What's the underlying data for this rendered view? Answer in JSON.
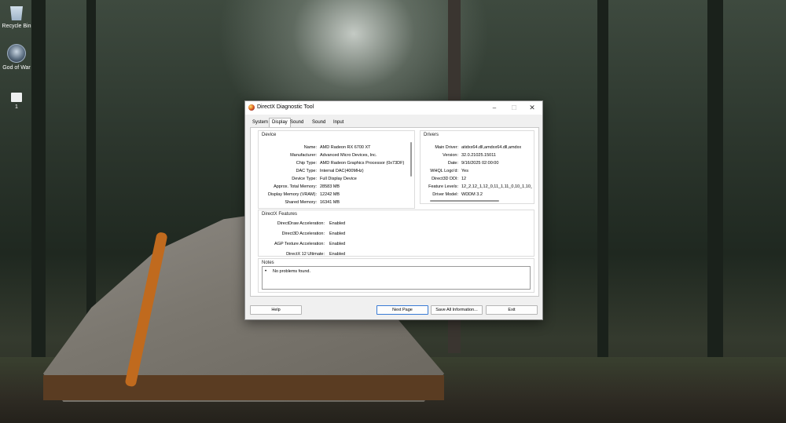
{
  "desktop": {
    "icons": [
      {
        "label": "Recycle Bin"
      },
      {
        "label": "God of War"
      },
      {
        "label": "1"
      }
    ]
  },
  "dialog": {
    "title": "DirectX Diagnostic Tool",
    "tabs": [
      "System",
      "Display",
      "Sound 1",
      "Sound 2",
      "Input"
    ],
    "active_tab": "Display",
    "device": {
      "label": "Device",
      "rows": [
        {
          "key": "Name:",
          "value": "AMD Radeon RX 6700 XT"
        },
        {
          "key": "Manufacturer:",
          "value": "Advanced Micro Devices, Inc."
        },
        {
          "key": "Chip Type:",
          "value": "AMD Radeon Graphics Processor (0x73DF)"
        },
        {
          "key": "DAC Type:",
          "value": "Internal DAC(400MHz)"
        },
        {
          "key": "Device Type:",
          "value": "Full Display Device"
        },
        {
          "key": "Approx. Total Memory:",
          "value": "28583 MB"
        },
        {
          "key": "Display Memory (VRAM):",
          "value": "12242 MB"
        },
        {
          "key": "Shared Memory:",
          "value": "16341 MB"
        }
      ]
    },
    "drivers": {
      "label": "Drivers",
      "rows": [
        {
          "key": "Main Driver:",
          "value": "atidxx64.dll,amdxx64.dll,amdxx"
        },
        {
          "key": "Version:",
          "value": "32.0.21025.15011"
        },
        {
          "key": "Date:",
          "value": "9/16/2025 02:00:00"
        },
        {
          "key": "WHQL Logo'd:",
          "value": "Yes"
        },
        {
          "key": "Direct3D DDI:",
          "value": "12"
        },
        {
          "key": "Feature Levels:",
          "value": "12_2,12_1,12_0,11_1,11_0,10_1,10_"
        },
        {
          "key": "Driver Model:",
          "value": "WDDM 3.2"
        }
      ]
    },
    "features": {
      "label": "DirectX Features",
      "rows": [
        {
          "key": "DirectDraw Acceleration:",
          "value": "Enabled"
        },
        {
          "key": "Direct3D Acceleration:",
          "value": "Enabled"
        },
        {
          "key": "AGP Texture Acceleration:",
          "value": "Enabled"
        },
        {
          "key": "DirectX 12 Ultimate:",
          "value": "Enabled"
        }
      ]
    },
    "notes": {
      "label": "Notes",
      "bullet": "•",
      "text": "No problems found."
    },
    "buttons": {
      "help": "Help",
      "next_page": "Next Page",
      "save_all": "Save All Information...",
      "exit": "Exit"
    },
    "window_controls": {
      "minimize": "–",
      "maximize": "☐",
      "close": "✕"
    }
  }
}
